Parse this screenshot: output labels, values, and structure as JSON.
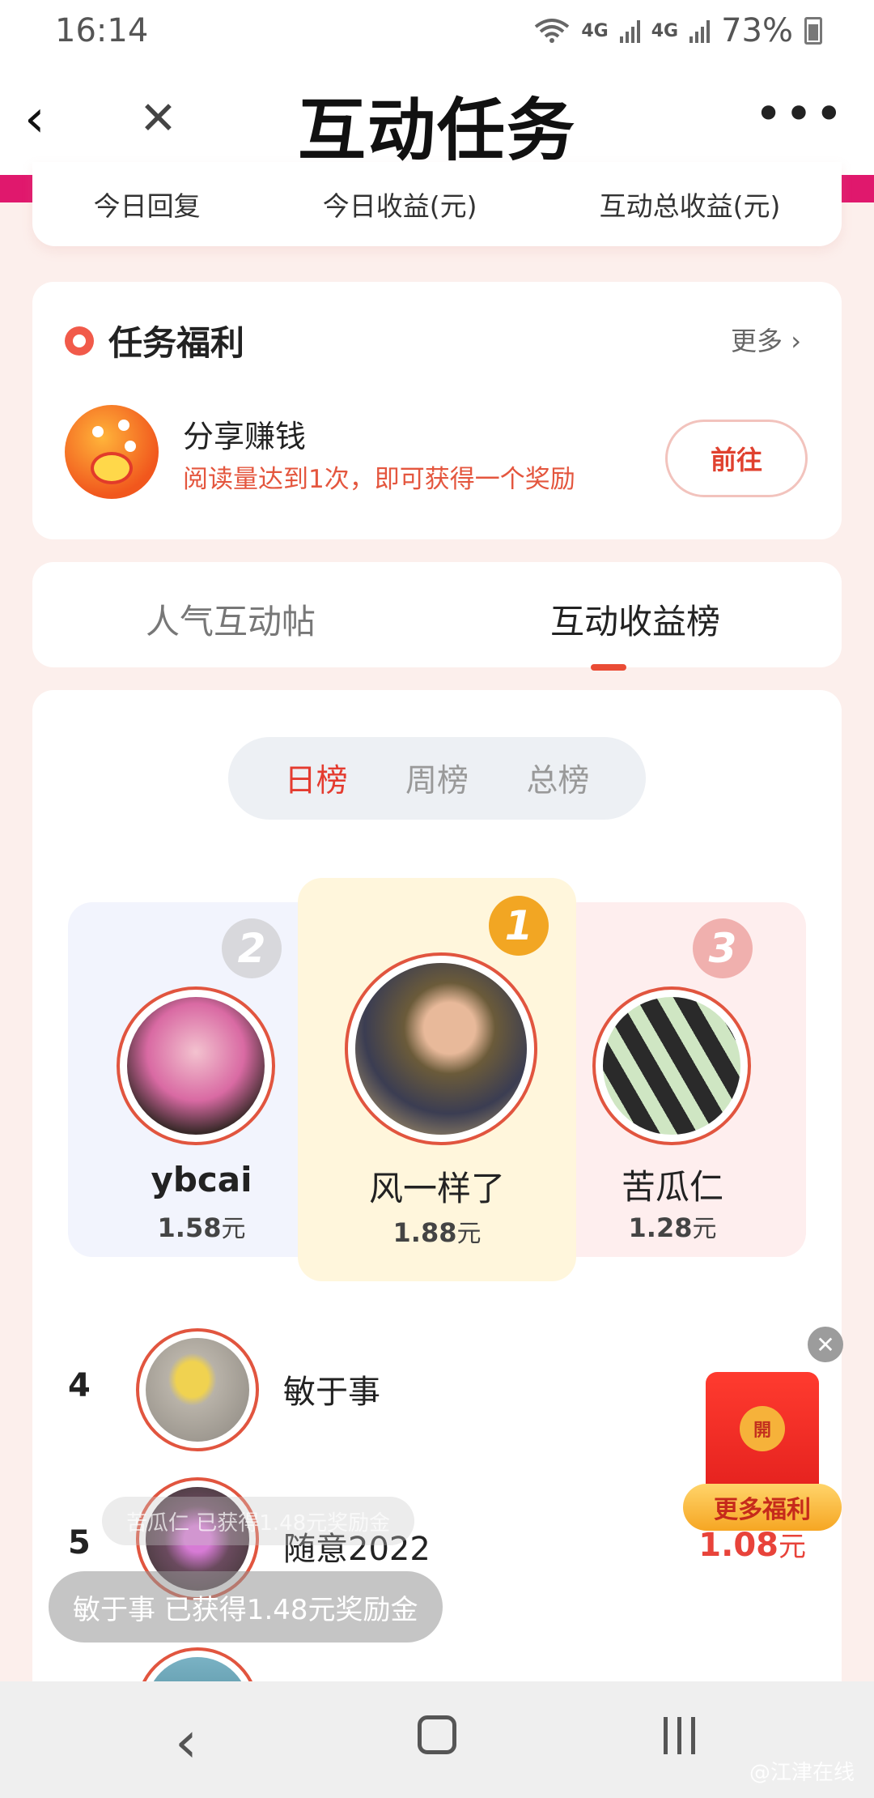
{
  "status_bar": {
    "time": "16:14",
    "signal1": "4G",
    "signal2": "4G",
    "battery": "73%"
  },
  "nav": {
    "back_icon": "‹",
    "close_icon": "✕",
    "title": "互动任务",
    "more_icon": "•••"
  },
  "stats": {
    "today_reply": "今日回复",
    "today_income": "今日收益(元)",
    "total_income": "互动总收益(元)"
  },
  "welfare": {
    "title": "任务福利",
    "more": "更多 ›",
    "task": {
      "title": "分享赚钱",
      "desc": "阅读量达到1次，即可获得一个奖励",
      "button": "前往"
    }
  },
  "tabs": {
    "popular": "人气互动帖",
    "earnings": "互动收益榜"
  },
  "segments": {
    "day": "日榜",
    "week": "周榜",
    "total": "总榜"
  },
  "podium": {
    "second": {
      "rank": "2",
      "name": "ybcai",
      "amount": "1.58",
      "unit": "元"
    },
    "first": {
      "rank": "1",
      "name": "风一样了",
      "amount": "1.88",
      "unit": "元"
    },
    "third": {
      "rank": "3",
      "name": "苦瓜仁",
      "amount": "1.28",
      "unit": "元"
    }
  },
  "list": [
    {
      "rank": "4",
      "name": "敏于事",
      "amount": "",
      "unit": ""
    },
    {
      "rank": "5",
      "name": "随意2022",
      "amount": "1.08",
      "unit": "元"
    }
  ],
  "toasts": {
    "faint": "苦瓜仁 已获得1.48元奖励金",
    "main": "敏于事   已获得1.48元奖励金"
  },
  "floating": {
    "close": "✕",
    "seal": "開",
    "label": "更多福利"
  },
  "watermark": "@江津在线",
  "colors": {
    "accent": "#e8433a",
    "gold": "#f6a623",
    "pink_edge": "#e0186d"
  }
}
